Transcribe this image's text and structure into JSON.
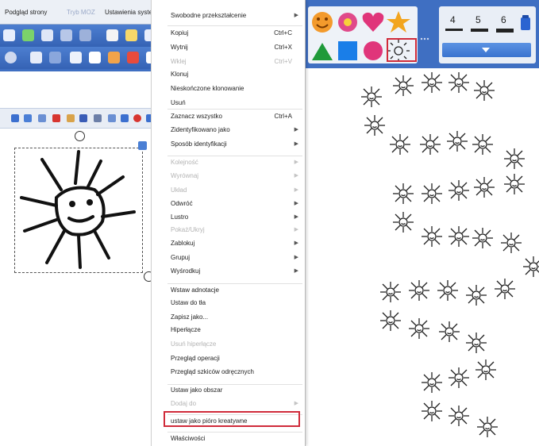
{
  "window": {
    "menu_tabs": [
      {
        "label": "Podgląd strony",
        "disabled": false
      },
      {
        "label": "Tryb MOZ",
        "disabled": true
      },
      {
        "label": "Ustawienia syste",
        "disabled": false
      }
    ]
  },
  "context_menu": {
    "items": [
      {
        "label": "Swobodne przekształcenie",
        "shortcut": "",
        "submenu": true,
        "disabled": false
      },
      {
        "label": "Kopiuj",
        "shortcut": "Ctrl+C",
        "submenu": false,
        "disabled": false
      },
      {
        "label": "Wytnij",
        "shortcut": "Ctrl+X",
        "submenu": false,
        "disabled": false
      },
      {
        "label": "Wklej",
        "shortcut": "Ctrl+V",
        "submenu": false,
        "disabled": true
      },
      {
        "label": "Klonuj",
        "shortcut": "",
        "submenu": false,
        "disabled": false
      },
      {
        "label": "Nieskończone klonowanie",
        "shortcut": "",
        "submenu": false,
        "disabled": false
      },
      {
        "label": "Usuń",
        "shortcut": "",
        "submenu": false,
        "disabled": false
      },
      {
        "label": "Zaznacz wszystko",
        "shortcut": "Ctrl+A",
        "submenu": false,
        "disabled": false
      },
      {
        "label": "Zidentyfikowano jako",
        "shortcut": "",
        "submenu": true,
        "disabled": false
      },
      {
        "label": "Sposób identyfikacji",
        "shortcut": "",
        "submenu": true,
        "disabled": false
      },
      {
        "label": "Kolejność",
        "shortcut": "",
        "submenu": true,
        "disabled": true
      },
      {
        "label": "Wyrównaj",
        "shortcut": "",
        "submenu": true,
        "disabled": true
      },
      {
        "label": "Układ",
        "shortcut": "",
        "submenu": true,
        "disabled": true
      },
      {
        "label": "Odwróć",
        "shortcut": "",
        "submenu": true,
        "disabled": false
      },
      {
        "label": "Lustro",
        "shortcut": "",
        "submenu": true,
        "disabled": false
      },
      {
        "label": "Pokaż/Ukryj",
        "shortcut": "",
        "submenu": true,
        "disabled": true
      },
      {
        "label": "Zablokuj",
        "shortcut": "",
        "submenu": true,
        "disabled": false
      },
      {
        "label": "Grupuj",
        "shortcut": "",
        "submenu": true,
        "disabled": false
      },
      {
        "label": "Wyśrodkuj",
        "shortcut": "",
        "submenu": true,
        "disabled": false
      },
      {
        "label": "Wstaw adnotacje",
        "shortcut": "",
        "submenu": false,
        "disabled": false
      },
      {
        "label": "Ustaw do tła",
        "shortcut": "",
        "submenu": false,
        "disabled": false
      },
      {
        "label": "Zapisz jako...",
        "shortcut": "",
        "submenu": false,
        "disabled": false
      },
      {
        "label": "Hiperłącze",
        "shortcut": "",
        "submenu": false,
        "disabled": false
      },
      {
        "label": "Usuń hiperłącze",
        "shortcut": "",
        "submenu": false,
        "disabled": true
      },
      {
        "label": "Przegląd operacji",
        "shortcut": "",
        "submenu": false,
        "disabled": false
      },
      {
        "label": "Przegląd szkiców odręcznych",
        "shortcut": "",
        "submenu": false,
        "disabled": false
      },
      {
        "label": "Ustaw jako obszar",
        "shortcut": "",
        "submenu": false,
        "disabled": false
      },
      {
        "label": "Dodaj do",
        "shortcut": "",
        "submenu": true,
        "disabled": true
      },
      {
        "label": "ustaw jako pióro kreatywne",
        "shortcut": "",
        "submenu": false,
        "disabled": false,
        "highlighted": true
      },
      {
        "label": "Właściwości",
        "shortcut": "",
        "submenu": false,
        "disabled": false
      }
    ]
  },
  "right_toolbar": {
    "line_widths": [
      "4",
      "5",
      "6"
    ],
    "shapes": [
      "smiley-icon",
      "flower-icon",
      "heart-icon",
      "star-icon",
      "triangle-icon",
      "square-icon",
      "circle-icon",
      "sun-pen-icon"
    ],
    "selected_shape": "sun-pen-icon",
    "highlight_color": "#d02b3a"
  }
}
